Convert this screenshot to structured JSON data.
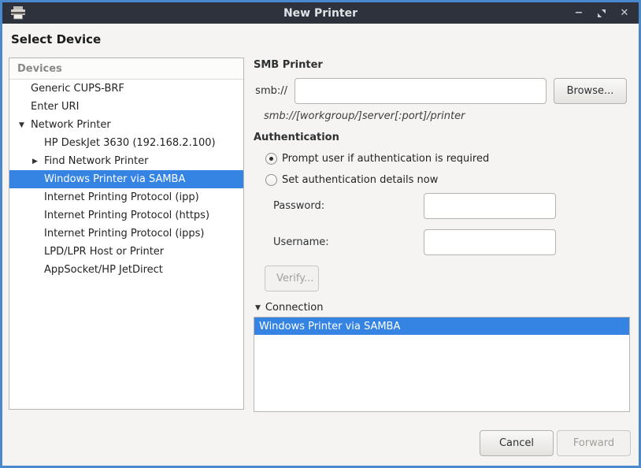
{
  "window": {
    "title": "New Printer",
    "controls": {
      "minimize": "−",
      "close": "✕"
    }
  },
  "page": {
    "heading": "Select Device"
  },
  "devices_panel": {
    "header": "Devices",
    "items": [
      {
        "label": "Generic CUPS-BRF",
        "level": 0,
        "expander": "",
        "selected": false
      },
      {
        "label": "Enter URI",
        "level": 0,
        "expander": "",
        "selected": false
      },
      {
        "label": "Network Printer",
        "level": 0,
        "expander": "open",
        "selected": false
      },
      {
        "label": "HP DeskJet 3630 (192.168.2.100)",
        "level": 1,
        "expander": "",
        "selected": false
      },
      {
        "label": "Find Network Printer",
        "level": 1,
        "expander": "closed",
        "selected": false
      },
      {
        "label": "Windows Printer via SAMBA",
        "level": 1,
        "expander": "",
        "selected": true
      },
      {
        "label": "Internet Printing Protocol (ipp)",
        "level": 1,
        "expander": "",
        "selected": false
      },
      {
        "label": "Internet Printing Protocol (https)",
        "level": 1,
        "expander": "",
        "selected": false
      },
      {
        "label": "Internet Printing Protocol (ipps)",
        "level": 1,
        "expander": "",
        "selected": false
      },
      {
        "label": "LPD/LPR Host or Printer",
        "level": 1,
        "expander": "",
        "selected": false
      },
      {
        "label": "AppSocket/HP JetDirect",
        "level": 1,
        "expander": "",
        "selected": false
      }
    ]
  },
  "smb": {
    "section_title": "SMB Printer",
    "uri_prefix": "smb://",
    "uri_value": "",
    "browse_label": "Browse...",
    "hint": "smb://[workgroup/]server[:port]/printer"
  },
  "auth": {
    "section_title": "Authentication",
    "options": [
      {
        "label": "Prompt user if authentication is required",
        "selected": true
      },
      {
        "label": "Set authentication details now",
        "selected": false
      }
    ],
    "password_label": "Password:",
    "password_value": "",
    "username_label": "Username:",
    "username_value": "",
    "verify_label": "Verify..."
  },
  "connection": {
    "expander_label": "Connection",
    "expanded": true,
    "items": [
      {
        "label": "Windows Printer via SAMBA",
        "selected": true
      }
    ]
  },
  "footer": {
    "cancel_label": "Cancel",
    "forward_label": "Forward"
  },
  "colors": {
    "selection": "#3584e4",
    "titlebar": "#2d323c",
    "window_border": "#4a89ce"
  }
}
